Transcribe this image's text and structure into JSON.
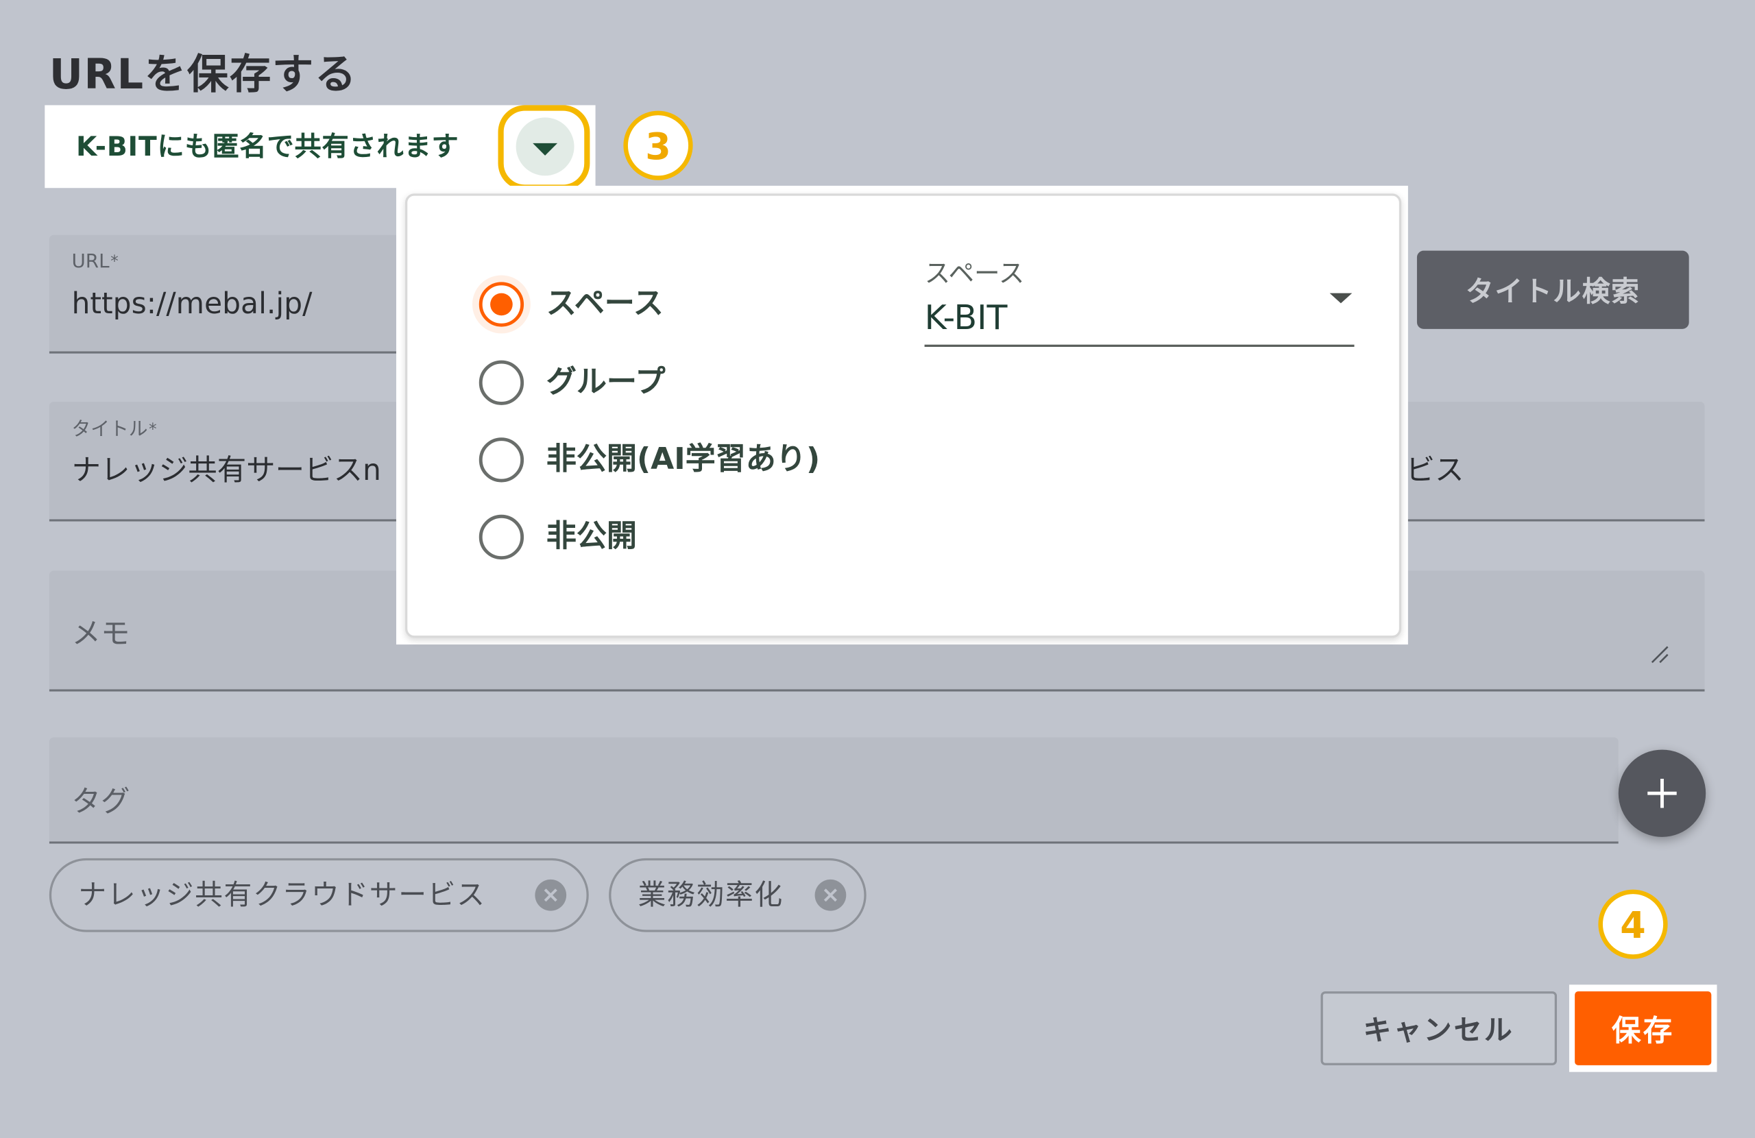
{
  "page": {
    "title": "URLを保存する"
  },
  "share": {
    "label": "K-BITにも匿名で共有されます",
    "toggle_icon": "caret-down-icon"
  },
  "annotations": [
    "3",
    "4"
  ],
  "fields": {
    "url": {
      "label": "URL",
      "required_mark": "*",
      "value": "https://mebal.jp/"
    },
    "title_search_button": "タイトル検索",
    "title": {
      "label": "タイトル",
      "required_mark": "*",
      "value": "ナレッジ共有サービスn",
      "value_end": "ビス"
    },
    "memo": {
      "placeholder": "メモ",
      "resize_icon": "resize-handle-icon"
    },
    "tags": {
      "placeholder": "タグ",
      "add_icon": "plus-icon",
      "chip_remove_icon": "close-circle-icon",
      "chips": [
        {
          "label": "ナレッジ共有クラウドサービス"
        },
        {
          "label": "業務効率化"
        }
      ]
    }
  },
  "popup": {
    "options": [
      {
        "label": "スペース",
        "selected": true
      },
      {
        "label": "グループ",
        "selected": false
      },
      {
        "label": "非公開(AI学習あり)",
        "selected": false
      },
      {
        "label": "非公開",
        "selected": false
      }
    ],
    "space_select": {
      "label": "スペース",
      "value": "K-BIT",
      "icon": "caret-down-icon"
    }
  },
  "actions": {
    "cancel": "キャンセル",
    "save": "保存"
  },
  "colors": {
    "background": "#c0c4cd",
    "field": "#b8bcc5",
    "accent": "#ff5f00",
    "annotation": "#f5b800",
    "share_text": "#1e4d36",
    "dark_button": "#5d5f66"
  }
}
